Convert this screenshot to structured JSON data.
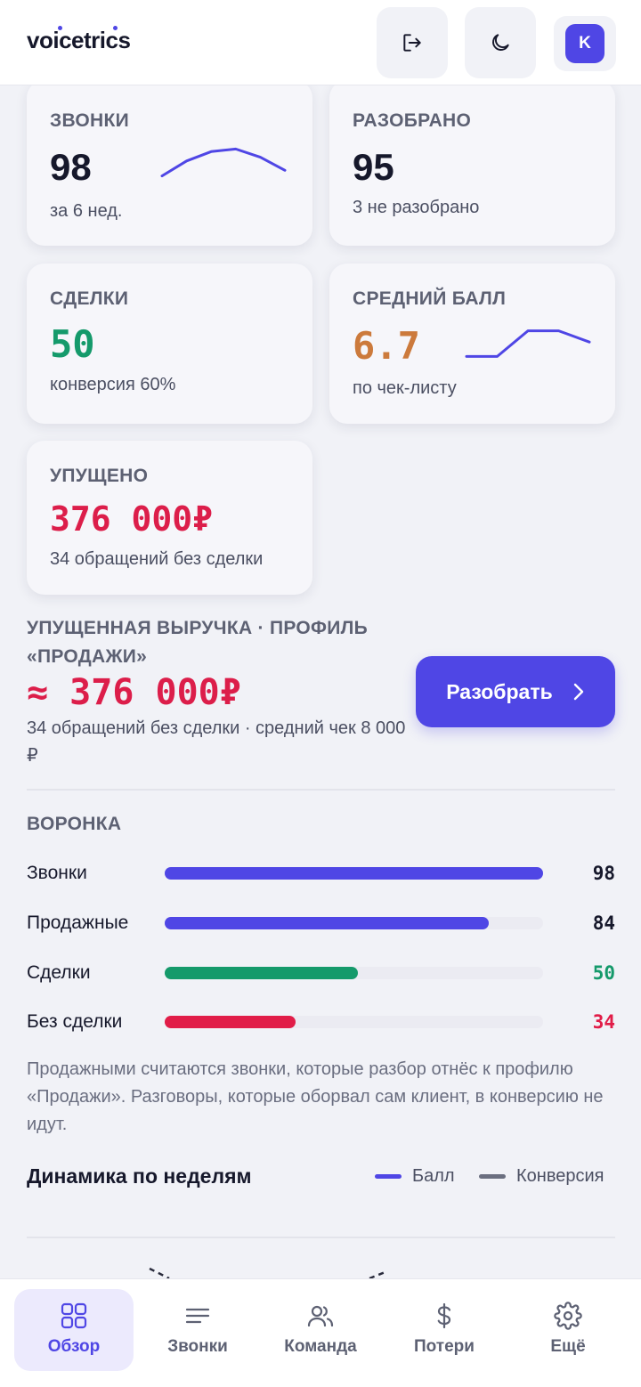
{
  "header": {
    "logo": "voicetrics",
    "avatar_initial": "K"
  },
  "kpis": {
    "calls": {
      "label": "ЗВОНКИ",
      "value": "98",
      "sub": "за 6 нед.",
      "trend": [
        0.2,
        0.6,
        0.85,
        0.92,
        0.7,
        0.35
      ]
    },
    "analyzed": {
      "label": "РАЗОБРАНО",
      "value": "95",
      "sub": "3 не разобрано"
    },
    "deals": {
      "label": "СДЕЛКИ",
      "value": "50",
      "sub": "конверсия 60%"
    },
    "avg_score": {
      "label": "СРЕДНИЙ БАЛЛ",
      "value": "6.7",
      "sub": "по чек-листу",
      "trend": [
        0.1,
        0.1,
        0.9,
        0.9,
        0.55
      ]
    },
    "missed": {
      "label": "УПУЩЕНО",
      "value": "376 000₽",
      "sub": "34 обращений без сделки"
    }
  },
  "lost_revenue": {
    "title": "УПУЩЕННАЯ ВЫРУЧКА · ПРОФИЛЬ «ПРОДАЖИ»",
    "value": "≈ 376 000₽",
    "sub": "34 обращений без сделки · средний чек 8 000 ₽",
    "cta_label": "Разобрать"
  },
  "funnel": {
    "title": "ВОРОНКА",
    "max": 98,
    "rows": [
      {
        "label": "Звонки",
        "value": 98,
        "color": "#4f46e5"
      },
      {
        "label": "Продажные",
        "value": 84,
        "color": "#4f46e5"
      },
      {
        "label": "Сделки",
        "value": 50,
        "color": "#159a6b"
      },
      {
        "label": "Без сделки",
        "value": 34,
        "color": "#e11d48"
      }
    ],
    "note": "Продажными считаются звонки, которые разбор отнёс к профилю «Продажи». Разговоры, которые оборвал сам клиент, в конверсию не идут."
  },
  "dynamics": {
    "title": "Динамика по неделям",
    "legend": [
      {
        "label": "Балл",
        "color": "#4f46e5"
      },
      {
        "label": "Конверсия",
        "color": "#6b6f80"
      }
    ]
  },
  "colors": {
    "accent": "#4f46e5",
    "green": "#159a6b",
    "orange": "#cc7a3c",
    "red": "#dc1e4a"
  },
  "nav": [
    {
      "label": "Обзор",
      "icon": "grid-icon",
      "active": true
    },
    {
      "label": "Звонки",
      "icon": "list-icon",
      "active": false
    },
    {
      "label": "Команда",
      "icon": "users-icon",
      "active": false
    },
    {
      "label": "Потери",
      "icon": "dollar-icon",
      "active": false
    },
    {
      "label": "Ещё",
      "icon": "gear-icon",
      "active": false
    }
  ]
}
